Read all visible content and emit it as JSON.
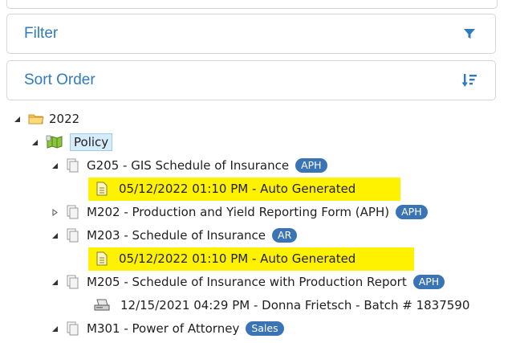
{
  "panels": {
    "filter": {
      "title": "Filter",
      "icon": "filter-funnel-icon"
    },
    "sort": {
      "title": "Sort Order",
      "icon": "sort-order-icon"
    }
  },
  "tree": {
    "year": {
      "label": "2022"
    },
    "policy": {
      "label": "Policy"
    },
    "forms": [
      {
        "label": "G205 - GIS Schedule of Insurance",
        "badge": "APH",
        "expanded": true,
        "children": [
          {
            "label": "05/12/2022 01:10 PM - Auto Generated",
            "highlighted": true
          }
        ]
      },
      {
        "label": "M202 - Production and Yield Reporting Form (APH)",
        "badge": "APH",
        "expanded": false,
        "children": []
      },
      {
        "label": "M203 - Schedule of Insurance",
        "badge": "AR",
        "expanded": true,
        "children": [
          {
            "label": "05/12/2022 01:10 PM - Auto Generated",
            "highlighted": true
          }
        ]
      },
      {
        "label": "M205 - Schedule of Insurance with Production Report",
        "badge": "APH",
        "expanded": true,
        "children": [
          {
            "label": "12/15/2021 04:29 PM - Donna Frietsch - Batch # 1837590",
            "highlighted": false
          }
        ]
      },
      {
        "label": "M301 - Power of Attorney",
        "badge": "Sales",
        "expanded": true,
        "children": []
      }
    ]
  },
  "colors": {
    "accent": "#2f7bbd",
    "badge": "#3a74b4",
    "highlight": "#fff200"
  }
}
